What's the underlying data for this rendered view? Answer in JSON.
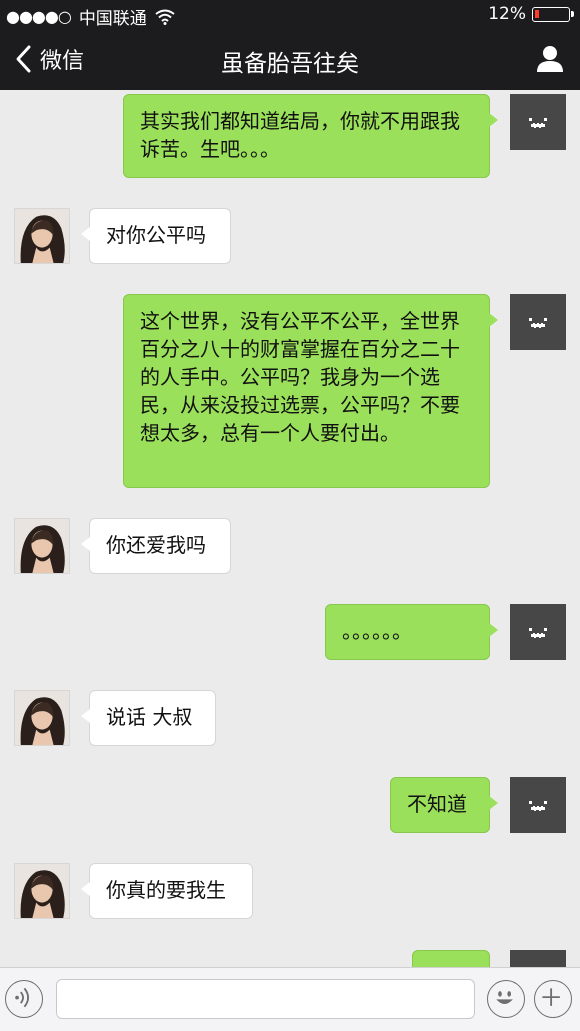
{
  "status_bar": {
    "signal": "●●●●○",
    "carrier": "中国联通",
    "battery_percent": "12%"
  },
  "nav": {
    "back_label": "微信",
    "title": "虽备胎吾往矣"
  },
  "messages": [
    {
      "sender": "me",
      "text": "其实我们都知道结局，你就不用跟我诉苦。生吧。。。"
    },
    {
      "sender": "her",
      "text": "对你公平吗"
    },
    {
      "sender": "me",
      "text": "这个世界，没有公平不公平，全世界百分之八十的财富掌握在百分之二十的人手中。公平吗？我身为一个选民，从来没投过选票，公平吗？不要想太多，总有一个人要付出。"
    },
    {
      "sender": "her",
      "text": "你还爱我吗"
    },
    {
      "sender": "me",
      "text": "。。。。。。"
    },
    {
      "sender": "her",
      "text": "说话 大叔"
    },
    {
      "sender": "me",
      "text": "不知道"
    },
    {
      "sender": "her",
      "text": "你真的要我生"
    },
    {
      "sender": "me",
      "text": ""
    }
  ],
  "input": {
    "value": "",
    "placeholder": ""
  },
  "colors": {
    "bubble_me": "#9be05a",
    "bubble_her": "#ffffff",
    "chat_bg": "#ebebeb",
    "bar_bg": "#1c1c1e",
    "battery_low": "#ff3b30"
  }
}
